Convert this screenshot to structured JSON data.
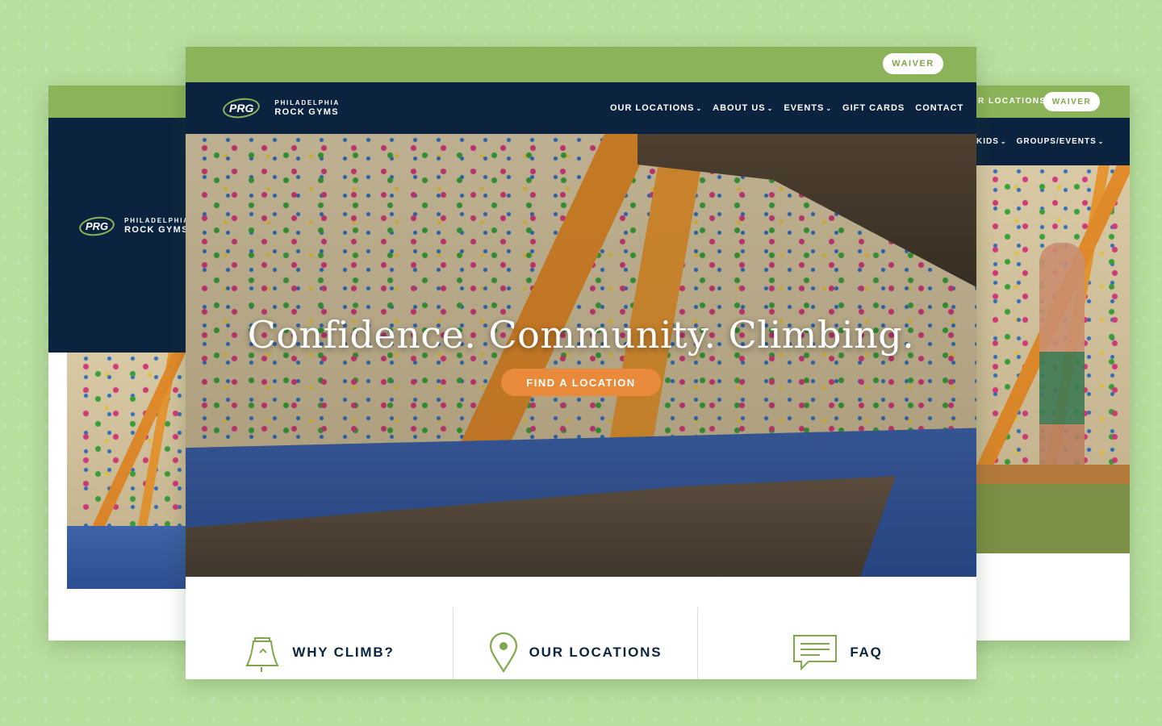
{
  "brand": {
    "badge": "PRG",
    "line1": "PHILADELPHIA",
    "line2": "ROCK GYMS"
  },
  "waiver_label": "WAIVER",
  "main": {
    "nav": [
      {
        "label": "OUR LOCATIONS",
        "dropdown": true
      },
      {
        "label": "ABOUT US",
        "dropdown": true
      },
      {
        "label": "EVENTS",
        "dropdown": true
      },
      {
        "label": "GIFT CARDS",
        "dropdown": false
      },
      {
        "label": "CONTACT",
        "dropdown": false
      }
    ],
    "hero": {
      "title": "Confidence. Community. Climbing.",
      "cta": "FIND A LOCATION"
    },
    "features": [
      {
        "label": "WHY CLIMB?",
        "icon": "bell-icon"
      },
      {
        "label": "OUR LOCATIONS",
        "icon": "map-pin-icon"
      },
      {
        "label": "FAQ",
        "icon": "chat-bubble-icon"
      }
    ]
  },
  "right_card": {
    "top_link": "R LOCATIONS",
    "nav": [
      {
        "label": "KIDS",
        "dropdown": true
      },
      {
        "label": "GROUPS/EVENTS",
        "dropdown": true
      }
    ]
  },
  "colors": {
    "green": "#8db35a",
    "navy": "#0c2340",
    "orange": "#e98a3b",
    "background": "#b9df9f"
  }
}
